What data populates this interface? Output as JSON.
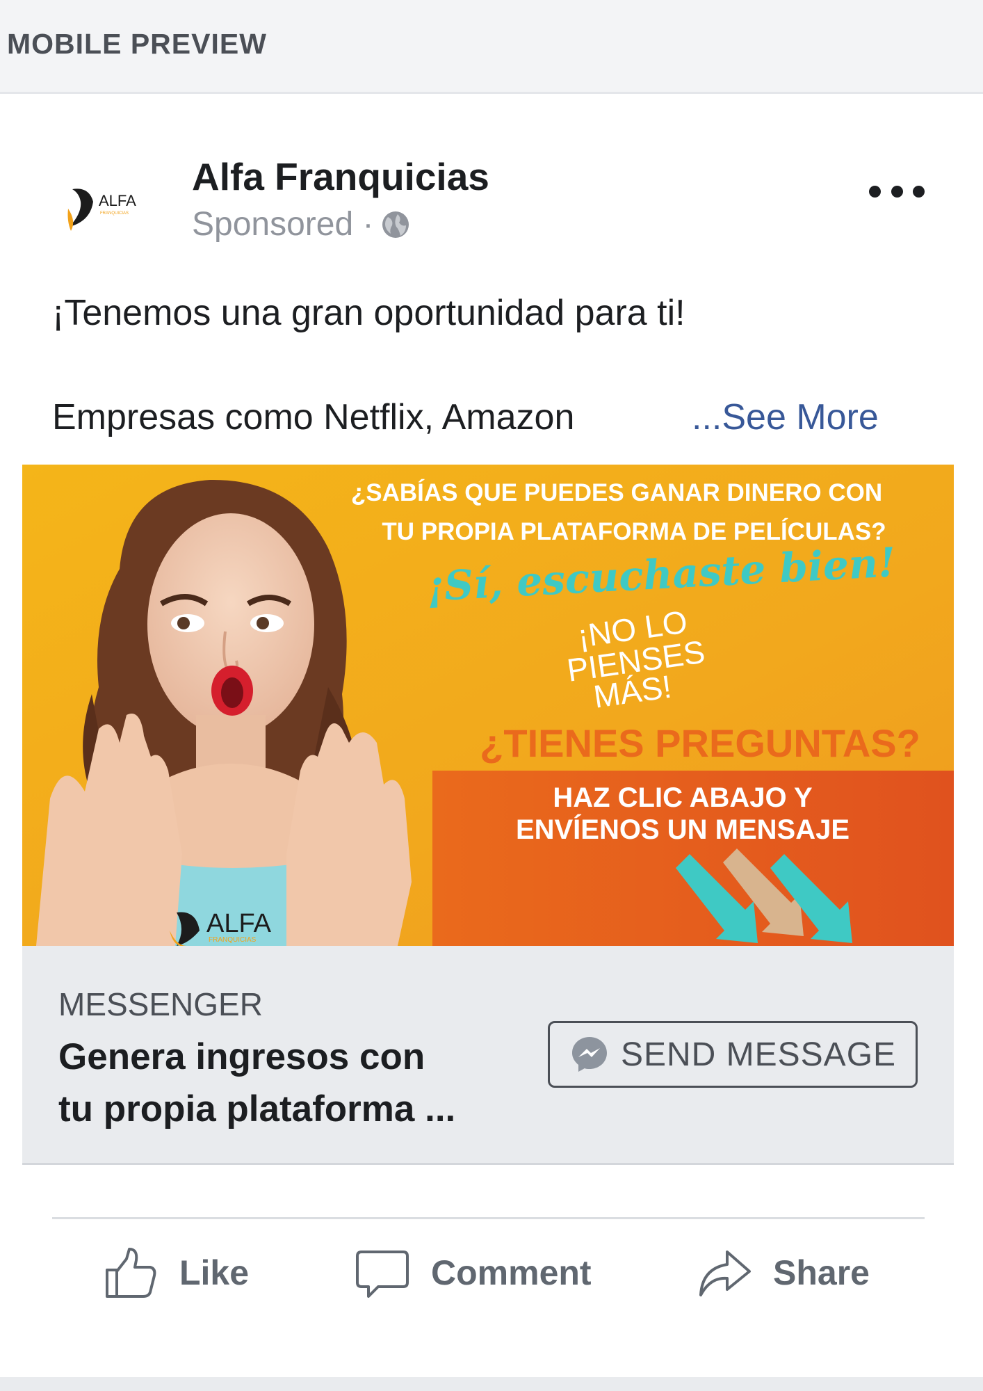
{
  "preview": {
    "title": "MOBILE PREVIEW"
  },
  "post": {
    "page_name": "Alfa Franquicias",
    "sponsored_label": "Sponsored ·",
    "avatar_text": "ALFA",
    "avatar_subtext": "FRANQUICIAS",
    "text_line1": "¡Tenemos una gran oportunidad para ti!",
    "text_line2": "Empresas como Netflix, Amazon",
    "see_more": "...See More"
  },
  "creative": {
    "headline_line1": "¿SABÍAS QUE PUEDES GANAR DINERO CON",
    "headline_line2": "TU PROPIA PLATAFORMA DE PELÍCULAS?",
    "script_line": "¡Sí, escuchaste bien!",
    "think_line1": "¡NO LO",
    "think_line2": "PIENSES",
    "think_line3": "MÁS!",
    "questions": "¿TIENES PREGUNTAS?",
    "click_line1": "HAZ CLIC ABAJO Y",
    "click_line2": "ENVÍENOS UN MENSAJE",
    "logo_text": "ALFA",
    "logo_subtext": "FRANQUICIAS"
  },
  "cta": {
    "source": "MESSENGER",
    "headline_line1": "Genera ingresos con",
    "headline_line2": "tu propia plataforma ...",
    "button_label": "SEND MESSAGE"
  },
  "actions": {
    "like": "Like",
    "comment": "Comment",
    "share": "Share"
  },
  "icons": {
    "globe": "globe-icon",
    "more": "more-dots-icon",
    "messenger": "messenger-icon",
    "like": "thumbs-up-icon",
    "comment": "speech-bubble-icon",
    "share": "share-arrow-icon"
  },
  "colors": {
    "accent_link": "#385898",
    "text_primary": "#1c1e21",
    "text_secondary": "#90949c",
    "cta_background": "#e9ebee",
    "creative_yellow": "#f2b01e",
    "creative_orange": "#e0531d",
    "creative_teal": "#3fc9c4"
  }
}
